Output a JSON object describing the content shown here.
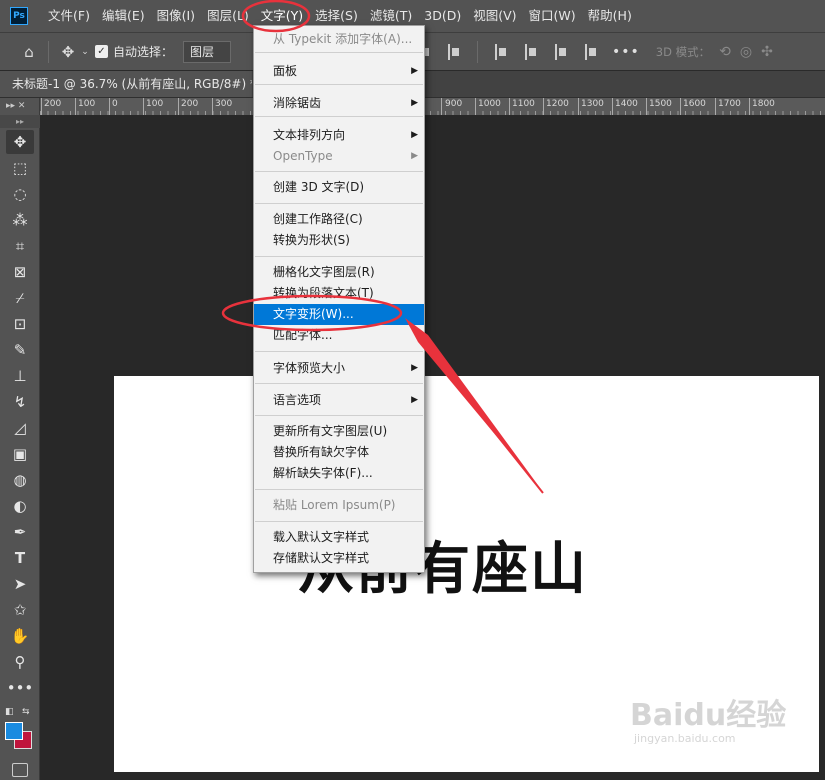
{
  "app": {
    "logo_text": "Ps"
  },
  "menubar": {
    "items": [
      {
        "label": "文件(F)"
      },
      {
        "label": "编辑(E)"
      },
      {
        "label": "图像(I)"
      },
      {
        "label": "图层(L)"
      },
      {
        "label": "文字(Y)"
      },
      {
        "label": "选择(S)"
      },
      {
        "label": "滤镜(T)"
      },
      {
        "label": "3D(D)"
      },
      {
        "label": "视图(V)"
      },
      {
        "label": "窗口(W)"
      },
      {
        "label": "帮助(H)"
      }
    ],
    "active_index": 4
  },
  "options_bar": {
    "home_icon": "home-icon",
    "move_icon": "move-icon",
    "auto_select_checked": true,
    "auto_select_label": "自动选择：",
    "layer_select_value": "图层",
    "mode_3d_label": "3D 模式："
  },
  "document": {
    "tab_title": "未标题-1 @ 36.7% (从前有座山, RGB/8#) *",
    "canvas_text": "从前有座山"
  },
  "ruler": {
    "corner": "▸▸ ✕",
    "labels": [
      "200",
      "100",
      "0",
      "100",
      "200",
      "300",
      "900",
      "1000",
      "1100",
      "1200",
      "1300",
      "1400",
      "1500",
      "1600",
      "1700",
      "1800"
    ]
  },
  "text_menu": {
    "items": [
      {
        "label": "从 Typekit 添加字体(A)...",
        "disabled": true
      },
      {
        "label": "面板",
        "submenu": true
      },
      {
        "label": "消除锯齿",
        "submenu": true
      },
      {
        "label": "文本排列方向",
        "submenu": true
      },
      {
        "label": "OpenType",
        "submenu": true,
        "disabled": true
      },
      {
        "label": "创建 3D 文字(D)"
      },
      {
        "label": "创建工作路径(C)"
      },
      {
        "label": "转换为形状(S)"
      },
      {
        "label": "栅格化文字图层(R)"
      },
      {
        "label": "转换为段落文本(T)"
      },
      {
        "label": "文字变形(W)...",
        "highlighted": true
      },
      {
        "label": "匹配字体..."
      },
      {
        "label": "字体预览大小",
        "submenu": true
      },
      {
        "label": "语言选项",
        "submenu": true
      },
      {
        "label": "更新所有文字图层(U)"
      },
      {
        "label": "替换所有缺欠字体"
      },
      {
        "label": "解析缺失字体(F)..."
      },
      {
        "label": "粘贴 Lorem Ipsum(P)",
        "disabled": true
      },
      {
        "label": "载入默认文字样式"
      },
      {
        "label": "存储默认文字样式"
      }
    ]
  },
  "watermark": {
    "main": "Baidu经验",
    "sub": "jingyan.baidu.com"
  },
  "colors": {
    "foreground": "#1a8be0",
    "background": "#c0143c",
    "highlight": "#0078d7",
    "annotation": "#e8323c"
  }
}
